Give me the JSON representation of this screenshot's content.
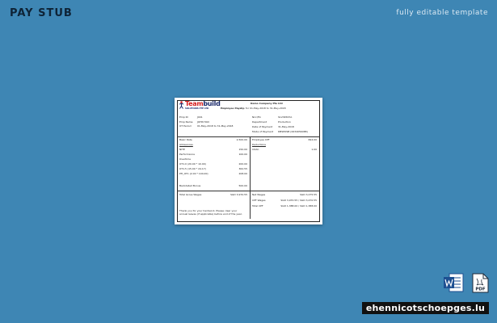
{
  "header": {
    "title": "PAY STUB",
    "subtitle": "fully editable template"
  },
  "logo": {
    "word_a": "Team",
    "word_b": "build",
    "tagline": "SOLUTIONS PTE LTD"
  },
  "doc": {
    "company": "Demo Company Pte Ltd",
    "period_label": "Employee Payslip",
    "period_value": "for 01-May-2018   to 31-May-2018",
    "info_left": [
      {
        "label": "Emp ID",
        "value": "J001"
      },
      {
        "label": "Emp Name",
        "value": "JOHN TAN"
      },
      {
        "label": "OT Period",
        "value": "01-May-2018   to  31-May-2018"
      }
    ],
    "info_right": [
      {
        "label": "Nric/Fin",
        "value": "S1234567A"
      },
      {
        "label": "Department",
        "value": "Production"
      },
      {
        "label": "Date of Payment",
        "value": "31-May-2018"
      },
      {
        "label": "Mode of Payment",
        "value": "DBSPOSB (0034056088)"
      }
    ],
    "earnings": {
      "basic_label": "Basic Rate",
      "basic_value": "2,500.00",
      "allowances_label": "Allowances",
      "allowances": [
        {
          "label": "NITE",
          "value": "150.00"
        },
        {
          "label": "Performance",
          "value": "100.00"
        }
      ],
      "overtime_label": "Overtime",
      "overtime": [
        {
          "label": "OT1.0 (20.00 * 10.00)",
          "value": "200.00"
        },
        {
          "label": "OT1.5 (15.00 * 24.17)",
          "value": "362.55"
        },
        {
          "label": "PH_OT1 (2.00 * 104.00)",
          "value": "208.00"
        }
      ],
      "bonus_label": "Backdated Bonus",
      "bonus_value": "500.00"
    },
    "deductions": {
      "cpf_label": "Employee CPF",
      "cpf_value": "694.00",
      "deductions_label": "Deductions",
      "items": [
        {
          "label": "CDAC",
          "value": "1.00"
        }
      ]
    },
    "totals_left": {
      "label": "Total Gross Wages",
      "value": "SGD 3,970.55",
      "note_line1": "Thank you for your hardwork. Please clear your",
      "note_line2": "annual leaves (if applicable) before end of the year."
    },
    "totals_right": [
      {
        "label": "Net Wages",
        "value": "SGD 3,275.55"
      },
      {
        "label": "CPF Wages",
        "value": "SGD 3,970.55 / SGD 3,470.55"
      },
      {
        "label": "Total CPF",
        "value": "SGD 1,388.00 / SGD 1,388.00"
      }
    ]
  },
  "file_icons": {
    "word": "word-icon",
    "pdf": "pdf-icon",
    "pdf_text": "PDF"
  },
  "colors": {
    "background": "#3e86b4",
    "title": "#0e2336",
    "subtitle": "#dbe9f3",
    "word_blue": "#1d4f91"
  },
  "watermark": "ehennicotschoepges.lu"
}
